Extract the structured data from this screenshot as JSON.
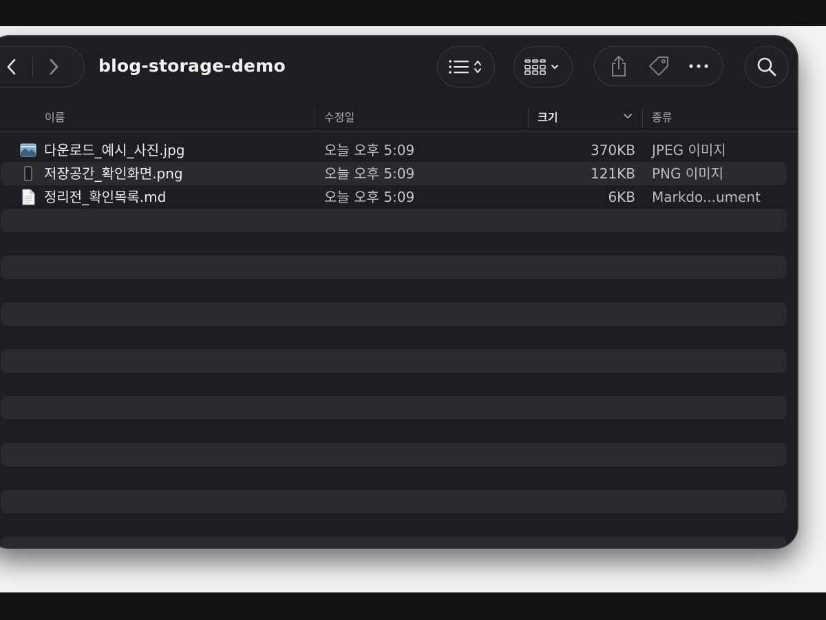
{
  "window": {
    "title": "blog-storage-demo"
  },
  "toolbar": {
    "back_icon": "chevron-left-icon",
    "forward_icon": "chevron-right-icon",
    "view_icon": "list-view-icon",
    "group_icon": "icon-grid-icon",
    "share_icon": "share-icon",
    "tag_icon": "tag-icon",
    "more_icon": "ellipsis-icon",
    "search_icon": "search-icon"
  },
  "columns": {
    "name": "이름",
    "date": "수정일",
    "size": "크기",
    "kind": "종류"
  },
  "files": [
    {
      "name": "다운로드_예시_사진.jpg",
      "date": "오늘 오후 5:09",
      "size": "370KB",
      "kind": "JPEG 이미지",
      "icon": "image-file-icon"
    },
    {
      "name": "저장공간_확인화면.png",
      "date": "오늘 오후 5:09",
      "size": "121KB",
      "kind": "PNG 이미지",
      "icon": "png-file-icon"
    },
    {
      "name": "정리전_확인목록.md",
      "date": "오늘 오후 5:09",
      "size": "6KB",
      "kind": "Markdo...ument",
      "icon": "document-file-icon"
    }
  ],
  "colors": {
    "window_bg": "#1d1e21",
    "stripe_bg": "#2a2b2e",
    "text_primary": "#ececee"
  }
}
